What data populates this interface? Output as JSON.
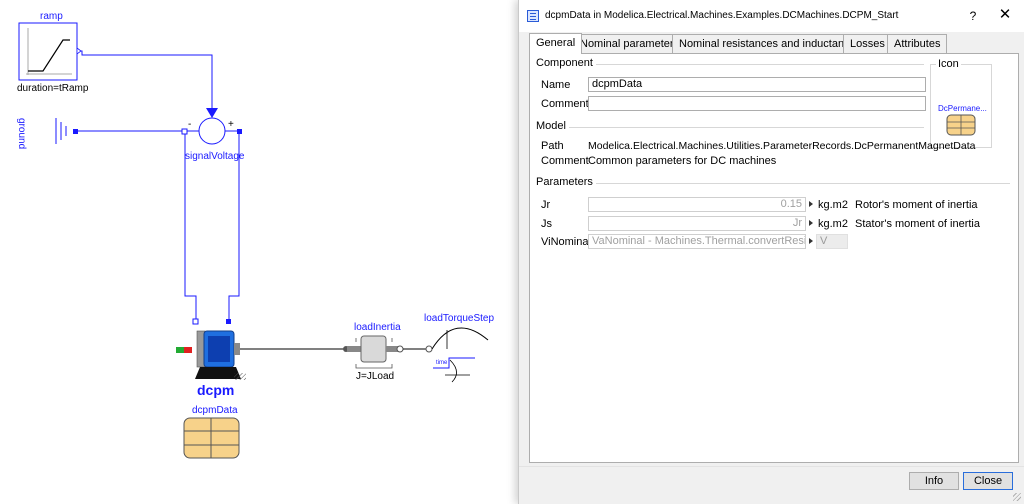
{
  "diagram": {
    "components": {
      "ramp": "ramp",
      "ramp_param": "duration=tRamp",
      "ground": "ground",
      "signal_voltage": "signalVoltage",
      "minus_sign": "-",
      "plus_sign": "+",
      "dcpm": "dcpm",
      "load_inertia": "loadInertia",
      "load_param": "J=JLoad",
      "load_torque_step": "loadTorqueStep",
      "time_label": "time",
      "record": "dcpmData"
    }
  },
  "dialog": {
    "title": "dcpmData in Modelica.Electrical.Machines.Examples.DCMachines.DCPM_Start",
    "help_label": "?",
    "close_label": "✕",
    "tabs": [
      "General",
      "Nominal parameters",
      "Nominal resistances and inductances",
      "Losses",
      "Attributes"
    ],
    "active_tab": "General",
    "component": {
      "title": "Component",
      "name_label": "Name",
      "name_value": "dcpmData",
      "comment_label": "Comment",
      "comment_value": ""
    },
    "icon": {
      "title": "Icon",
      "name": "DcPermane..."
    },
    "model": {
      "title": "Model",
      "path_label": "Path",
      "path_value": "Modelica.Electrical.Machines.Utilities.ParameterRecords.DcPermanentMagnetData",
      "comment_label": "Comment",
      "comment_value": "Common parameters for DC machines"
    },
    "parameters": {
      "title": "Parameters",
      "rows": [
        {
          "name": "Jr",
          "value": "0.15",
          "unit": "kg.m2",
          "desc": "Rotor's moment of inertia"
        },
        {
          "name": "Js",
          "value": "Jr",
          "unit": "kg.m2",
          "desc": "Stator's moment of inertia"
        },
        {
          "name": "ViNominal",
          "value": "VaNominal - Machines.Thermal.convertResistance(",
          "unit": "V",
          "desc": ""
        }
      ]
    },
    "buttons": {
      "info": "Info",
      "close": "Close"
    }
  },
  "colors": {
    "connector_blue": "#0000ff",
    "diagram_label": "#1a1aff",
    "record_fill": "#f7d28a",
    "motor_blue": "#1f6fe0"
  }
}
